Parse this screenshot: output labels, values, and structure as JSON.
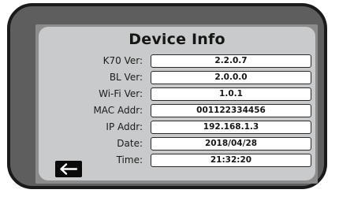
{
  "screen": {
    "title": "Device Info"
  },
  "rows": [
    {
      "label": "K70 Ver:",
      "value": "2.2.0.7"
    },
    {
      "label": "BL Ver:",
      "value": "2.0.0.0"
    },
    {
      "label": "Wi-Fi Ver:",
      "value": "1.0.1"
    },
    {
      "label": "MAC Addr:",
      "value": "001122334456"
    },
    {
      "label": "IP Addr:",
      "value": "192.168.1.3"
    },
    {
      "label": "Date:",
      "value": "2018/04/28"
    },
    {
      "label": "Time:",
      "value": "21:32:20"
    }
  ],
  "back_button": {
    "icon": "arrow-left-icon"
  },
  "colors": {
    "frame": "#5e5e5e",
    "screen": "#c9cacb",
    "field": "#ffffff",
    "button": "#0a0a0a"
  }
}
